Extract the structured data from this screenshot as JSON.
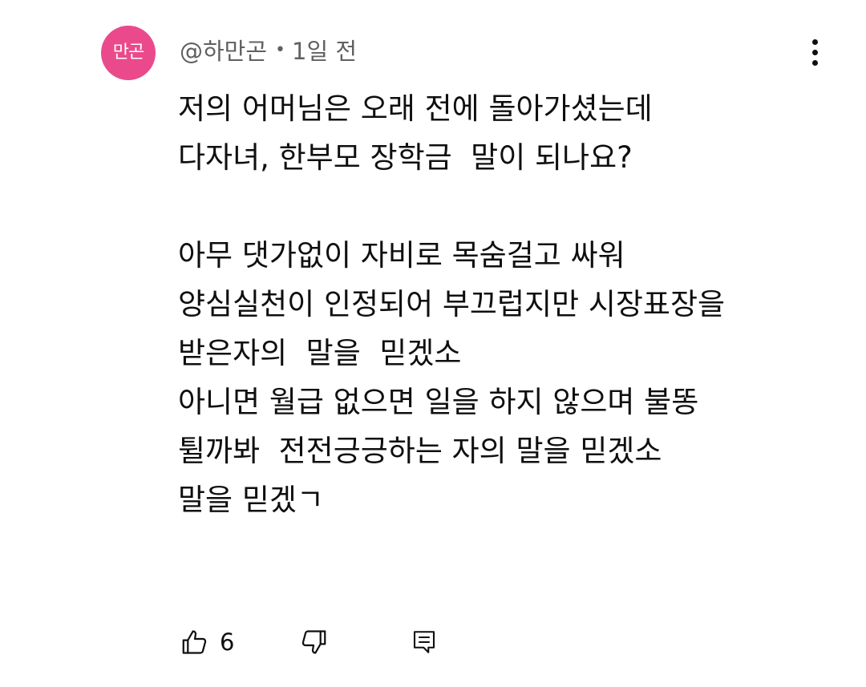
{
  "comment": {
    "avatar_text": "만곤",
    "author": "@하만곤",
    "separator": "•",
    "timestamp": "1일 전",
    "lines": [
      "저의 어머님은 오래 전에 돌아가셨는데",
      "다자녀, 한부모 장학금  말이 되나요?",
      "",
      "아무 댓가없이 자비로 목숨걸고 싸워",
      "양심실천이 인정되어 부끄럽지만 시장표장을",
      "받은자의  말을  믿겠소",
      "아니면 월급 없으면 일을 하지 않으며 불똥",
      "튈까봐  전전긍긍하는 자의 말을 믿겠소",
      "말을 믿겠ㄱ"
    ],
    "like_count": "6",
    "avatar_color": "#ea4a8c"
  },
  "icons": {
    "more": "more-vert-icon",
    "like": "thumbs-up-icon",
    "dislike": "thumbs-down-icon",
    "reply": "reply-comment-icon"
  }
}
